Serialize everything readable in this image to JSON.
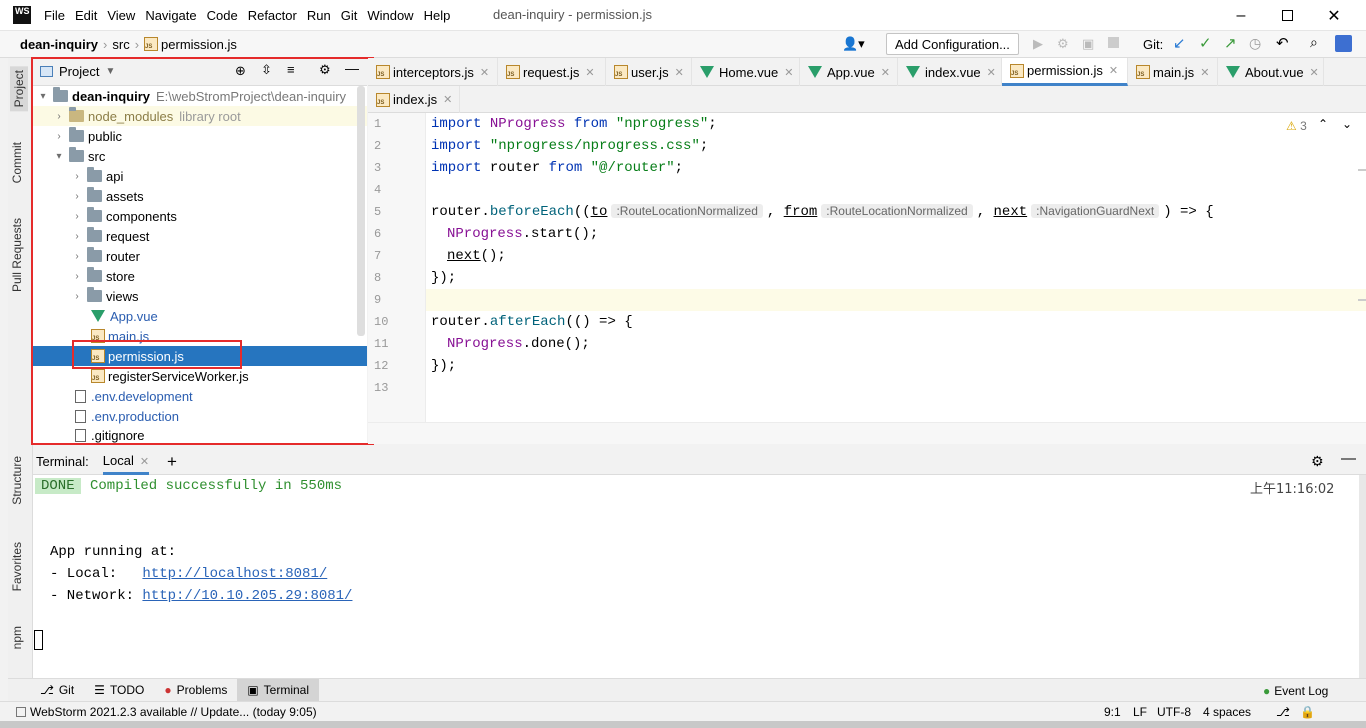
{
  "app": {
    "logo": "WS",
    "menu": [
      "File",
      "Edit",
      "View",
      "Navigate",
      "Code",
      "Refactor",
      "Run",
      "Git",
      "Window",
      "Help"
    ],
    "window_title": "dean-inquiry - permission.js"
  },
  "breadcrumb": [
    "dean-inquiry",
    "src",
    "permission.js"
  ],
  "toolbar": {
    "add_config": "Add Configuration...",
    "git_label": "Git:"
  },
  "side_tabs": {
    "project": "Project",
    "commit": "Commit",
    "pull_requests": "Pull Requests",
    "structure": "Structure",
    "favorites": "Favorites",
    "npm": "npm"
  },
  "project": {
    "header": "Project",
    "root": {
      "name": "dean-inquiry",
      "path": "E:\\webStromProject\\dean-inquiry"
    },
    "items": [
      {
        "label": "node_modules",
        "extra": "library root"
      },
      {
        "label": "public"
      },
      {
        "label": "src"
      },
      {
        "label": "api"
      },
      {
        "label": "assets"
      },
      {
        "label": "components"
      },
      {
        "label": "request"
      },
      {
        "label": "router"
      },
      {
        "label": "store"
      },
      {
        "label": "views"
      },
      {
        "label": "App.vue"
      },
      {
        "label": "main.js"
      },
      {
        "label": "permission.js"
      },
      {
        "label": "registerServiceWorker.js"
      },
      {
        "label": ".env.development"
      },
      {
        "label": ".env.production"
      },
      {
        "label": ".gitignore"
      }
    ]
  },
  "editor_tabs": {
    "row1": [
      "interceptors.js",
      "request.js",
      "user.js",
      "Home.vue",
      "App.vue",
      "index.vue",
      "permission.js",
      "main.js",
      "About.vue"
    ],
    "row2": [
      "index.js"
    ]
  },
  "editor": {
    "warnings": "3",
    "line_numbers": [
      "1",
      "2",
      "3",
      "4",
      "5",
      "6",
      "7",
      "8",
      "9",
      "10",
      "11",
      "12",
      "13"
    ],
    "lines": {
      "l1": {
        "a": "import",
        "b": " NProgress ",
        "c": "from",
        "d": " \"nprogress\"",
        "e": ";"
      },
      "l2": {
        "a": "import",
        "d": " \"nprogress/nprogress.css\"",
        "e": ";"
      },
      "l3": {
        "a": "import",
        "b": " router ",
        "c": "from",
        "d": " \"@/router\"",
        "e": ";"
      },
      "l5": {
        "obj": "router.",
        "fn": "beforeEach",
        "open": "((",
        "p1": "to",
        "h1": ":RouteLocationNormalized",
        "sep1": ", ",
        "p2": "from",
        "h2": ":RouteLocationNormalized",
        "sep2": ", ",
        "p3": "next",
        "h3": ":NavigationGuardNext",
        "close": ") => {"
      },
      "l6": {
        "np": "NProgress",
        "rest": ".start();"
      },
      "l7": {
        "fn": "next",
        "rest": "();"
      },
      "l8": "});",
      "l10": {
        "obj": "router.",
        "fn": "afterEach",
        "rest": "(() => {"
      },
      "l11": {
        "np": "NProgress",
        "rest": ".done();"
      },
      "l12": "});"
    }
  },
  "terminal": {
    "label": "Terminal:",
    "tab": "Local",
    "done": "DONE",
    "compiled": "Compiled successfully in 550ms",
    "time": "上午11:16:02",
    "running": "App running at:",
    "local_label": "- Local:   ",
    "local_url": "http://localhost:8081/",
    "network_label": "- Network: ",
    "network_url": "http://10.10.205.29:8081/"
  },
  "bottom_tabs": [
    "Git",
    "TODO",
    "Problems",
    "Terminal"
  ],
  "event_log": "Event Log",
  "status": {
    "message": "WebStorm 2021.2.3 available // Update... (today 9:05)",
    "pos": "9:1",
    "lf": "LF",
    "enc": "UTF-8",
    "indent": "4 spaces"
  },
  "colors": {
    "accent": "#4083c9",
    "selection": "#2675bf",
    "highlight_box": "#e52b2b",
    "done_bg": "#c7eac7"
  }
}
